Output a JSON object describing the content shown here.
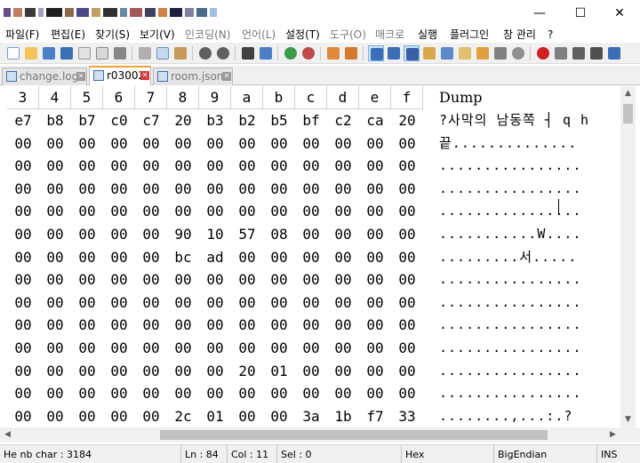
{
  "window": {
    "minimize": "—",
    "maximize": "☐",
    "close": "✕"
  },
  "menu": [
    "파일(F)",
    "편집(E)",
    "찾기(S)",
    "보기(V)",
    "인코딩(N)",
    "언어(L)",
    "설정(T)",
    "도구(O)",
    "매크로",
    "실행",
    "플러그인",
    "창 관리",
    "?"
  ],
  "tabs": [
    {
      "label": "change.log",
      "active": false
    },
    {
      "label": "r03002",
      "active": true
    },
    {
      "label": "room.json",
      "active": false
    }
  ],
  "hex_view": {
    "columns": [
      "3",
      "4",
      "5",
      "6",
      "7",
      "8",
      "9",
      "a",
      "b",
      "c",
      "d",
      "e",
      "f"
    ],
    "dump_label": "Dump",
    "rows": [
      {
        "bytes": [
          "e7",
          "b8",
          "b7",
          "c0",
          "c7",
          "20",
          "b3",
          "b2",
          "b5",
          "bf",
          "c2",
          "ca",
          "20"
        ],
        "dump": "?사막의 남동쪽 ┤ q h"
      },
      {
        "bytes": [
          "00",
          "00",
          "00",
          "00",
          "00",
          "00",
          "00",
          "00",
          "00",
          "00",
          "00",
          "00",
          "00"
        ],
        "dump": "끝.............."
      },
      {
        "bytes": [
          "00",
          "00",
          "00",
          "00",
          "00",
          "00",
          "00",
          "00",
          "00",
          "00",
          "00",
          "00",
          "00"
        ],
        "dump": "................"
      },
      {
        "bytes": [
          "00",
          "00",
          "00",
          "00",
          "00",
          "00",
          "00",
          "00",
          "00",
          "00",
          "00",
          "00",
          "00"
        ],
        "dump": "................"
      },
      {
        "bytes": [
          "00",
          "00",
          "00",
          "00",
          "00",
          "00",
          "00",
          "00",
          "00",
          "00",
          "00",
          "00",
          "00"
        ],
        "dump": "................"
      },
      {
        "bytes": [
          "00",
          "00",
          "00",
          "00",
          "00",
          "90",
          "10",
          "57",
          "08",
          "00",
          "00",
          "00",
          "00"
        ],
        "dump": "...........W...."
      },
      {
        "bytes": [
          "00",
          "00",
          "00",
          "00",
          "00",
          "bc",
          "ad",
          "00",
          "00",
          "00",
          "00",
          "00",
          "00"
        ],
        "dump": ".........서....."
      },
      {
        "bytes": [
          "00",
          "00",
          "00",
          "00",
          "00",
          "00",
          "00",
          "00",
          "00",
          "00",
          "00",
          "00",
          "00"
        ],
        "dump": "................"
      },
      {
        "bytes": [
          "00",
          "00",
          "00",
          "00",
          "00",
          "00",
          "00",
          "00",
          "00",
          "00",
          "00",
          "00",
          "00"
        ],
        "dump": "................"
      },
      {
        "bytes": [
          "00",
          "00",
          "00",
          "00",
          "00",
          "00",
          "00",
          "00",
          "00",
          "00",
          "00",
          "00",
          "00"
        ],
        "dump": "................"
      },
      {
        "bytes": [
          "00",
          "00",
          "00",
          "00",
          "00",
          "00",
          "00",
          "00",
          "00",
          "00",
          "00",
          "00",
          "00"
        ],
        "dump": "................"
      },
      {
        "bytes": [
          "00",
          "00",
          "00",
          "00",
          "00",
          "00",
          "00",
          "20",
          "01",
          "00",
          "00",
          "00",
          "00"
        ],
        "dump": "................"
      },
      {
        "bytes": [
          "00",
          "00",
          "00",
          "00",
          "00",
          "00",
          "00",
          "00",
          "00",
          "00",
          "00",
          "00",
          "00"
        ],
        "dump": "................"
      },
      {
        "bytes": [
          "00",
          "00",
          "00",
          "00",
          "00",
          "2c",
          "01",
          "00",
          "00",
          "3a",
          "1b",
          "f7",
          "33"
        ],
        "dump": "........,...:.?"
      }
    ]
  },
  "status": {
    "hex_char": "He nb char : 3184",
    "ln": "Ln : 84",
    "col": "Col : 11",
    "sel": "Sel : 0",
    "mode": "Hex",
    "endian": "BigEndian",
    "ins": "INS"
  }
}
